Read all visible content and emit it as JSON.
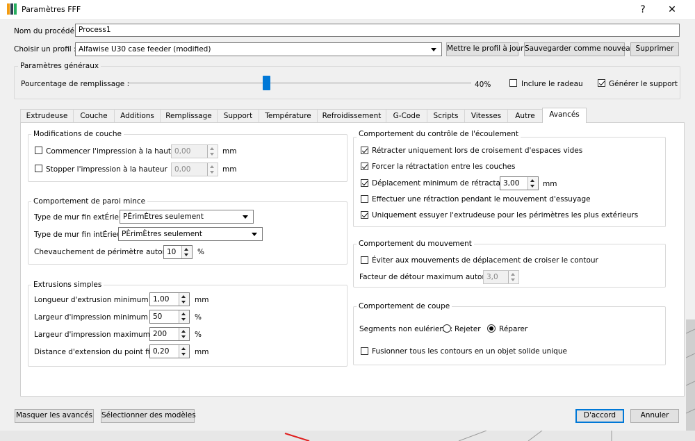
{
  "window": {
    "title": "Paramètres FFF",
    "help": "?",
    "close": "✕",
    "icon_colors": [
      "#f39c12",
      "#2c3e50",
      "#27ae60"
    ]
  },
  "top": {
    "name_label": "Nom du procédé :",
    "name_value": "Process1",
    "profile_label": "Choisir un profil :",
    "profile_value": "Alfawise U30 case feeder (modified)",
    "update_btn": "Mettre le profil à jour",
    "save_new_btn": "Sauvegarder comme nouveau",
    "delete_btn": "Supprimer"
  },
  "general": {
    "title": "Paramètres généraux",
    "infill_label": "Pourcentage de remplissage :",
    "infill_value": "40%",
    "infill_fraction": 0.4,
    "raft_label": "Inclure le radeau",
    "raft_checked": false,
    "support_label": "Générer le support",
    "support_checked": true
  },
  "tabs": [
    "Extrudeuse",
    "Couche",
    "Additions",
    "Remplissage",
    "Support",
    "Température",
    "Refroidissement",
    "G-Code",
    "Scripts",
    "Vitesses",
    "Autre",
    "Avancés"
  ],
  "active_tab": "Avancés",
  "layer_mods": {
    "title": "Modifications de couche",
    "start_label": "Commencer l'impression à la hauteur",
    "start_value": "0,00",
    "stop_label": "Stopper  l'impression à la hauteur",
    "stop_value": "0,00",
    "unit": "mm"
  },
  "thin_wall": {
    "title": "Comportement de paroi mince",
    "outer_label": "Type de mur fin extÉrieur",
    "outer_value": "PÉrimÈtres seulement",
    "inner_label": "Type de mur fin intÉrieur",
    "inner_value": "PÈrimÈtres seulement",
    "overlap_label": "Chevauchement de périmètre autorisé",
    "overlap_value": "10",
    "overlap_unit": "%"
  },
  "extrusions": {
    "title": "Extrusions simples",
    "rows": [
      {
        "label": "Longueur d'extrusion minimum",
        "value": "1,00",
        "unit": "mm"
      },
      {
        "label": "Largeur d'impression minimum",
        "value": "50",
        "unit": "%"
      },
      {
        "label": "Largeur d'impression maximum",
        "value": "200",
        "unit": "%"
      },
      {
        "label": "Distance d'extension du point final",
        "value": "0,20",
        "unit": "mm"
      }
    ]
  },
  "flow": {
    "title": "Comportement du contrôle de l'écoulement",
    "retract_crossing": "Rétracter uniquement lors de croisement d'espaces vides",
    "force_retract": "Forcer la rétractation entre les couches",
    "min_travel": "Déplacement minimum de rétractation",
    "min_travel_value": "3,00",
    "min_travel_unit": "mm",
    "wipe": "Effectuer une rétraction pendant le mouvement d'essuyage",
    "wipe_outer": "Uniquement essuyer l'extrudeuse pour les périmètres les plus extérieurs"
  },
  "movement": {
    "title": "Comportement du mouvement",
    "avoid": "Éviter aux mouvements de déplacement de croiser le contour",
    "detour_label": "Facteur de détour maximum autorisé",
    "detour_value": "3,0"
  },
  "cutting": {
    "title": "Comportement de coupe",
    "segments_label": "Segments non eulériens :",
    "reject": "Rejeter",
    "repair": "Réparer",
    "merge": "Fusionner tous les contours en un objet solide unique"
  },
  "bottom": {
    "hide_advanced": "Masquer les avancés",
    "select_models": "Sélectionner des modèles",
    "ok": "D'accord",
    "cancel": "Annuler"
  }
}
